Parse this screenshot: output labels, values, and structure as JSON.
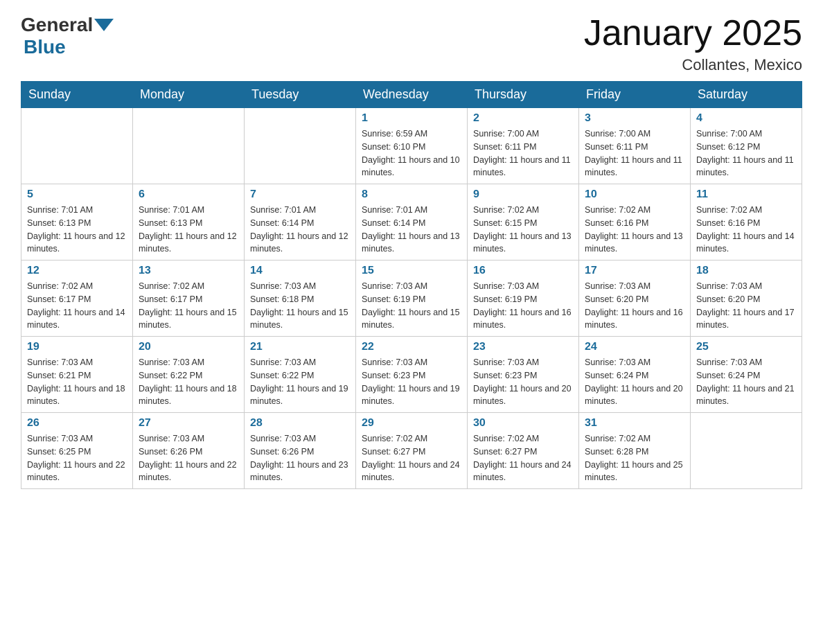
{
  "header": {
    "logo_general": "General",
    "logo_blue": "Blue",
    "month_title": "January 2025",
    "location": "Collantes, Mexico"
  },
  "days_of_week": [
    "Sunday",
    "Monday",
    "Tuesday",
    "Wednesday",
    "Thursday",
    "Friday",
    "Saturday"
  ],
  "weeks": [
    [
      {
        "day": "",
        "sunrise": "",
        "sunset": "",
        "daylight": ""
      },
      {
        "day": "",
        "sunrise": "",
        "sunset": "",
        "daylight": ""
      },
      {
        "day": "",
        "sunrise": "",
        "sunset": "",
        "daylight": ""
      },
      {
        "day": "1",
        "sunrise": "Sunrise: 6:59 AM",
        "sunset": "Sunset: 6:10 PM",
        "daylight": "Daylight: 11 hours and 10 minutes."
      },
      {
        "day": "2",
        "sunrise": "Sunrise: 7:00 AM",
        "sunset": "Sunset: 6:11 PM",
        "daylight": "Daylight: 11 hours and 11 minutes."
      },
      {
        "day": "3",
        "sunrise": "Sunrise: 7:00 AM",
        "sunset": "Sunset: 6:11 PM",
        "daylight": "Daylight: 11 hours and 11 minutes."
      },
      {
        "day": "4",
        "sunrise": "Sunrise: 7:00 AM",
        "sunset": "Sunset: 6:12 PM",
        "daylight": "Daylight: 11 hours and 11 minutes."
      }
    ],
    [
      {
        "day": "5",
        "sunrise": "Sunrise: 7:01 AM",
        "sunset": "Sunset: 6:13 PM",
        "daylight": "Daylight: 11 hours and 12 minutes."
      },
      {
        "day": "6",
        "sunrise": "Sunrise: 7:01 AM",
        "sunset": "Sunset: 6:13 PM",
        "daylight": "Daylight: 11 hours and 12 minutes."
      },
      {
        "day": "7",
        "sunrise": "Sunrise: 7:01 AM",
        "sunset": "Sunset: 6:14 PM",
        "daylight": "Daylight: 11 hours and 12 minutes."
      },
      {
        "day": "8",
        "sunrise": "Sunrise: 7:01 AM",
        "sunset": "Sunset: 6:14 PM",
        "daylight": "Daylight: 11 hours and 13 minutes."
      },
      {
        "day": "9",
        "sunrise": "Sunrise: 7:02 AM",
        "sunset": "Sunset: 6:15 PM",
        "daylight": "Daylight: 11 hours and 13 minutes."
      },
      {
        "day": "10",
        "sunrise": "Sunrise: 7:02 AM",
        "sunset": "Sunset: 6:16 PM",
        "daylight": "Daylight: 11 hours and 13 minutes."
      },
      {
        "day": "11",
        "sunrise": "Sunrise: 7:02 AM",
        "sunset": "Sunset: 6:16 PM",
        "daylight": "Daylight: 11 hours and 14 minutes."
      }
    ],
    [
      {
        "day": "12",
        "sunrise": "Sunrise: 7:02 AM",
        "sunset": "Sunset: 6:17 PM",
        "daylight": "Daylight: 11 hours and 14 minutes."
      },
      {
        "day": "13",
        "sunrise": "Sunrise: 7:02 AM",
        "sunset": "Sunset: 6:17 PM",
        "daylight": "Daylight: 11 hours and 15 minutes."
      },
      {
        "day": "14",
        "sunrise": "Sunrise: 7:03 AM",
        "sunset": "Sunset: 6:18 PM",
        "daylight": "Daylight: 11 hours and 15 minutes."
      },
      {
        "day": "15",
        "sunrise": "Sunrise: 7:03 AM",
        "sunset": "Sunset: 6:19 PM",
        "daylight": "Daylight: 11 hours and 15 minutes."
      },
      {
        "day": "16",
        "sunrise": "Sunrise: 7:03 AM",
        "sunset": "Sunset: 6:19 PM",
        "daylight": "Daylight: 11 hours and 16 minutes."
      },
      {
        "day": "17",
        "sunrise": "Sunrise: 7:03 AM",
        "sunset": "Sunset: 6:20 PM",
        "daylight": "Daylight: 11 hours and 16 minutes."
      },
      {
        "day": "18",
        "sunrise": "Sunrise: 7:03 AM",
        "sunset": "Sunset: 6:20 PM",
        "daylight": "Daylight: 11 hours and 17 minutes."
      }
    ],
    [
      {
        "day": "19",
        "sunrise": "Sunrise: 7:03 AM",
        "sunset": "Sunset: 6:21 PM",
        "daylight": "Daylight: 11 hours and 18 minutes."
      },
      {
        "day": "20",
        "sunrise": "Sunrise: 7:03 AM",
        "sunset": "Sunset: 6:22 PM",
        "daylight": "Daylight: 11 hours and 18 minutes."
      },
      {
        "day": "21",
        "sunrise": "Sunrise: 7:03 AM",
        "sunset": "Sunset: 6:22 PM",
        "daylight": "Daylight: 11 hours and 19 minutes."
      },
      {
        "day": "22",
        "sunrise": "Sunrise: 7:03 AM",
        "sunset": "Sunset: 6:23 PM",
        "daylight": "Daylight: 11 hours and 19 minutes."
      },
      {
        "day": "23",
        "sunrise": "Sunrise: 7:03 AM",
        "sunset": "Sunset: 6:23 PM",
        "daylight": "Daylight: 11 hours and 20 minutes."
      },
      {
        "day": "24",
        "sunrise": "Sunrise: 7:03 AM",
        "sunset": "Sunset: 6:24 PM",
        "daylight": "Daylight: 11 hours and 20 minutes."
      },
      {
        "day": "25",
        "sunrise": "Sunrise: 7:03 AM",
        "sunset": "Sunset: 6:24 PM",
        "daylight": "Daylight: 11 hours and 21 minutes."
      }
    ],
    [
      {
        "day": "26",
        "sunrise": "Sunrise: 7:03 AM",
        "sunset": "Sunset: 6:25 PM",
        "daylight": "Daylight: 11 hours and 22 minutes."
      },
      {
        "day": "27",
        "sunrise": "Sunrise: 7:03 AM",
        "sunset": "Sunset: 6:26 PM",
        "daylight": "Daylight: 11 hours and 22 minutes."
      },
      {
        "day": "28",
        "sunrise": "Sunrise: 7:03 AM",
        "sunset": "Sunset: 6:26 PM",
        "daylight": "Daylight: 11 hours and 23 minutes."
      },
      {
        "day": "29",
        "sunrise": "Sunrise: 7:02 AM",
        "sunset": "Sunset: 6:27 PM",
        "daylight": "Daylight: 11 hours and 24 minutes."
      },
      {
        "day": "30",
        "sunrise": "Sunrise: 7:02 AM",
        "sunset": "Sunset: 6:27 PM",
        "daylight": "Daylight: 11 hours and 24 minutes."
      },
      {
        "day": "31",
        "sunrise": "Sunrise: 7:02 AM",
        "sunset": "Sunset: 6:28 PM",
        "daylight": "Daylight: 11 hours and 25 minutes."
      },
      {
        "day": "",
        "sunrise": "",
        "sunset": "",
        "daylight": ""
      }
    ]
  ]
}
